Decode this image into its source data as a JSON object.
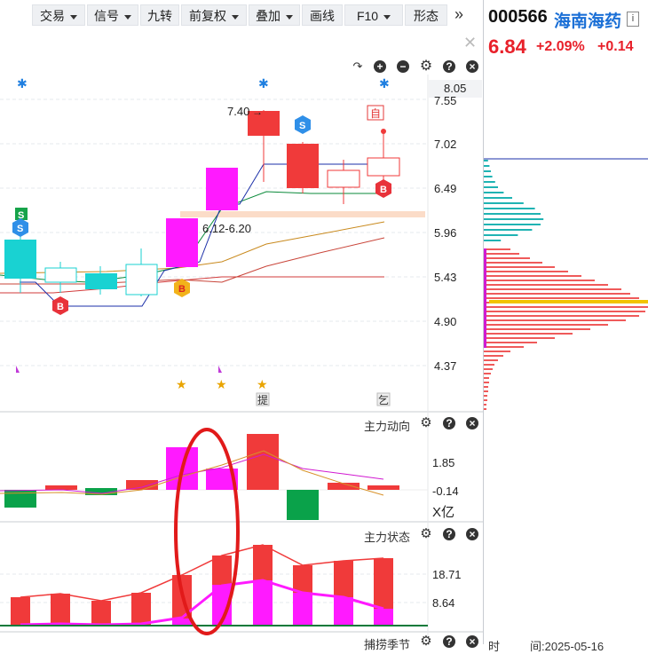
{
  "toolbar": {
    "buttons": [
      {
        "label": "交易",
        "dropdown": true
      },
      {
        "label": "信号",
        "dropdown": true
      },
      {
        "label": "九转",
        "dropdown": false
      },
      {
        "label": "前复权",
        "dropdown": true
      },
      {
        "label": "叠加",
        "dropdown": true
      },
      {
        "label": "画线",
        "dropdown": false
      },
      {
        "label": "F10",
        "dropdown": true
      },
      {
        "label": "形态",
        "dropdown": false
      }
    ],
    "more_icon": "double-chevron-right-icon"
  },
  "stock": {
    "code": "000566",
    "name": "海南海药",
    "info": "i",
    "price": "6.84",
    "change_pct": "+2.09%",
    "change": "+0.14"
  },
  "kline": {
    "price_axis": [
      "7.55",
      "7.02",
      "6.49",
      "5.96",
      "5.43",
      "4.90",
      "4.37"
    ],
    "current_price_label": "8.05",
    "annotation_high": "7.40",
    "annotation_range": "6.12-6.20",
    "marker_ti": "提",
    "marker_zi": "自",
    "marker_ba": "乞",
    "signals": {
      "S": "S",
      "B": "B"
    },
    "colors": {
      "up": "#f03a3a",
      "down": "#19d2d2",
      "up_magenta": "#ff1aff",
      "down_green": "#0aa24a"
    }
  },
  "panel_main_force": {
    "title": "主力动向",
    "axis": [
      "1.85",
      "-0.14"
    ],
    "unit": "X亿"
  },
  "panel_main_state": {
    "title": "主力状态",
    "axis": [
      "18.71",
      "8.64"
    ]
  },
  "footer": {
    "panel_title_partial": "捕捞季节",
    "left_partial": "时",
    "date_partial": "间:2025-05-16"
  }
}
